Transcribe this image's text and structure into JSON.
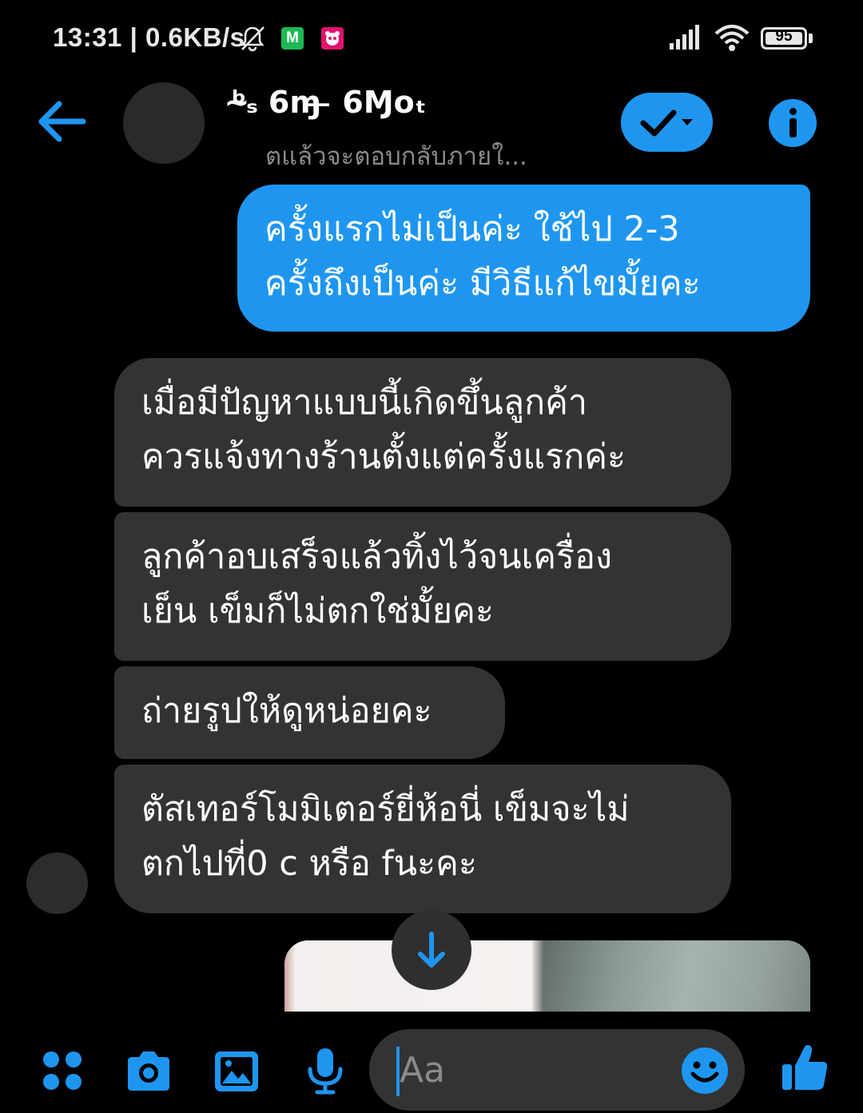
{
  "status_bar": {
    "time": "13:31 | 0.6KB/s",
    "app_badge_1": "M",
    "battery": "95"
  },
  "header": {
    "contact_name": "ᵇ̴ₛ 6ɱ ̶ 6Ɱoₜ",
    "contact_subtitle": "ตแล้วจะตอบกลับภายใ...",
    "accent_color": "#1e96f0"
  },
  "messages": [
    {
      "direction": "outgoing",
      "text": "ครั้งแรกไม่เป็นค่ะ ใช้ไป 2-3\nครั้งถึงเป็นค่ะ มีวิธีแก้ไขมั้ยคะ"
    },
    {
      "direction": "incoming",
      "text": "เมื่อมีปัญหาแบบนี้เกิดขึ้นลูกค้า\nควรแจ้งทางร้านตั้งแต่ครั้งแรกค่ะ"
    },
    {
      "direction": "incoming",
      "text": "ลูกค้าอบเสร็จแล้วทิ้งไว้จนเครื่อง\nเย็น เข็มก็ไม่ตกใช่มั้ยคะ"
    },
    {
      "direction": "incoming",
      "text": "ถ่ายรูปให้ดูหน่อยคะ"
    },
    {
      "direction": "incoming",
      "text": "ตัสเทอร์โมมิเตอร์ยี่ห้อนี่ เข็มจะไม่\nตกไปที่0 c หรือ fนะคะ"
    }
  ],
  "composer": {
    "placeholder": "Aa",
    "icons": [
      "apps-icon",
      "camera-icon",
      "gallery-icon",
      "microphone-icon",
      "emoji-icon",
      "like-icon"
    ]
  },
  "colors": {
    "outgoing_bubble": "#1e96f0",
    "incoming_bubble": "#333333",
    "background": "#000000"
  }
}
